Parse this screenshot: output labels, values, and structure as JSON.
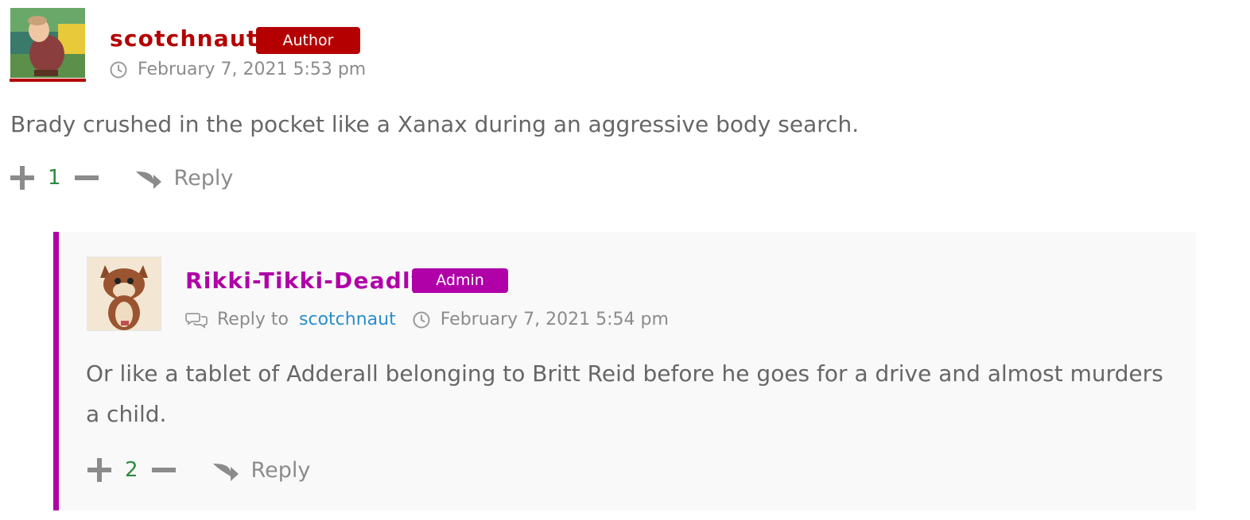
{
  "comments": [
    {
      "author": "scotchnaut",
      "badge": "Author",
      "date": "February 7, 2021 5:53 pm",
      "text": "Brady crushed in the pocket like a Xanax during an aggressive body search.",
      "votes": "1",
      "reply_label": "Reply",
      "accent_color": "#b40000"
    },
    {
      "author": "Rikki-Tikki-Deadly",
      "badge": "Admin",
      "reply_to_label": "Reply to",
      "reply_to_user": "scotchnaut",
      "date": "February 7, 2021 5:54 pm",
      "text": "Or like a tablet of Adderall belonging to Britt Reid before he goes for a drive and almost murders a child.",
      "votes": "2",
      "reply_label": "Reply",
      "accent_color": "#b000a8"
    }
  ],
  "icons": {
    "clock": "clock-icon",
    "upvote": "plus-icon",
    "downvote": "minus-icon",
    "reply": "reply-arrow-icon",
    "reply_to": "chat-bubbles-icon"
  }
}
